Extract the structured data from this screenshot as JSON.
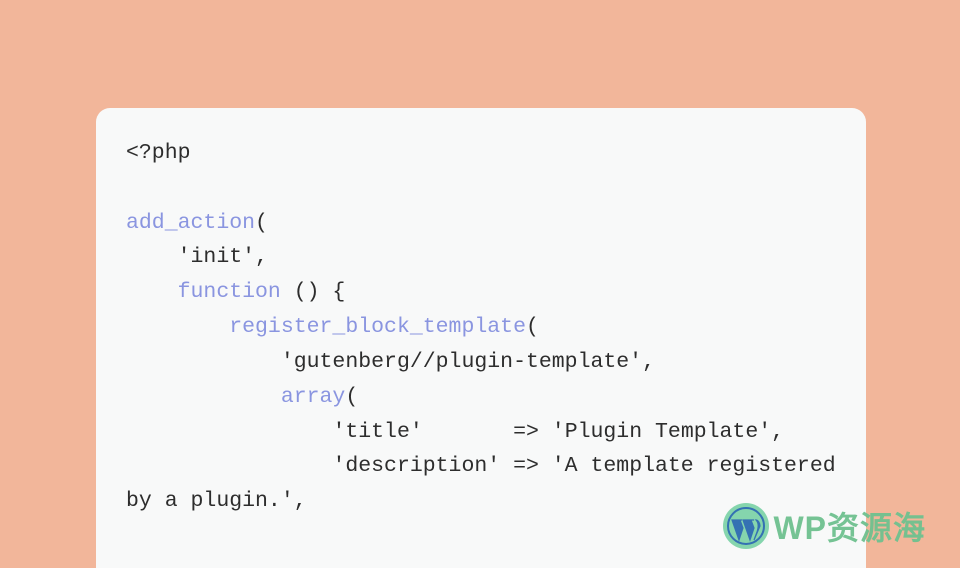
{
  "code": {
    "php_open": "<?php",
    "add_action": "add_action",
    "paren_open": "(",
    "init_str": "'init'",
    "comma": ",",
    "function_kw": "function",
    "fn_parens": " () {",
    "register_fn": "register_block_template",
    "paren_open2": "(",
    "template_str": "'gutenberg//plugin-template'",
    "array_kw": "array",
    "paren_open3": "(",
    "title_key": "'title'",
    "arrow1": "       => ",
    "title_val": "'Plugin Template'",
    "desc_key": "'description'",
    "arrow2": " => ",
    "desc_val": "'A template registered by a plugin.'"
  },
  "watermark": {
    "text": "WP资源海"
  }
}
